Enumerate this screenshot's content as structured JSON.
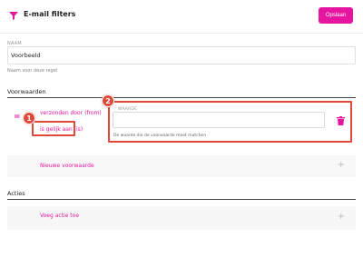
{
  "header": {
    "title": "E-mail filters",
    "save_label": "Opslaan",
    "icon": "filter-icon"
  },
  "name": {
    "label": "NAAM",
    "value": "Voorbeeld",
    "help": "Naam voor deze regel"
  },
  "conditions": {
    "title": "Voorwaarden",
    "items": [
      {
        "field": "verzonden door (from)",
        "operator": "is gelijk aan (is)",
        "value_label": "WAARDE",
        "value": "",
        "value_help": "De waarde die de voorwaarde moet matchen"
      }
    ],
    "add_label": "Nieuwe voorwaarde"
  },
  "actions": {
    "title": "Acties",
    "add_label": "Voeg actie toe"
  },
  "annotations": {
    "badge1": "1",
    "badge2": "2"
  },
  "colors": {
    "accent": "#e6159f",
    "highlight": "#e0493a"
  }
}
